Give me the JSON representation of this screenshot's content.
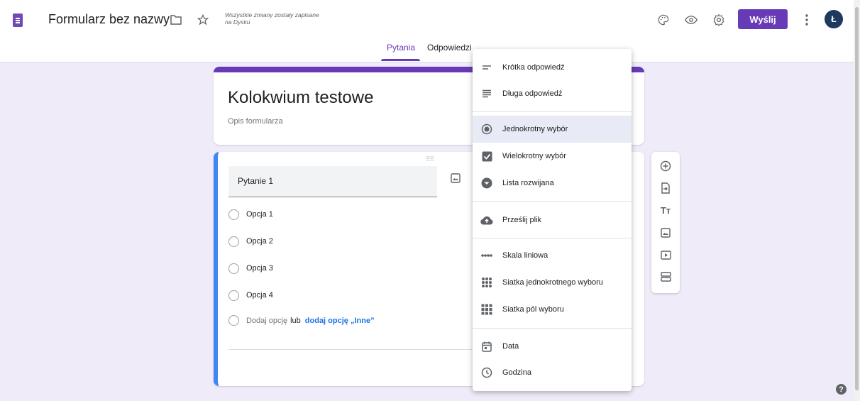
{
  "header": {
    "title": "Formularz bez nazwy",
    "save_status": "Wszystkie zmiany zostały zapisane na Dysku",
    "send_label": "Wyślij",
    "avatar_letter": "Ł",
    "icons": [
      "folder-icon",
      "star-icon",
      "palette-icon",
      "preview-icon",
      "settings-icon",
      "more-vert-icon"
    ],
    "brand_color": "#673ab7"
  },
  "tabs": [
    {
      "label": "Pytania",
      "active": true
    },
    {
      "label": "Odpowiedzi",
      "active": false
    }
  ],
  "form": {
    "title": "Kolokwium testowe",
    "description_placeholder": "Opis formularza"
  },
  "question": {
    "title": "Pytanie 1",
    "options": [
      "Opcja 1",
      "Opcja 2",
      "Opcja 3",
      "Opcja 4"
    ],
    "add_option": "Dodaj opcję",
    "or": "lub",
    "add_other": "dodaj opcję „Inne”"
  },
  "menu": {
    "items": [
      {
        "label": "Krótka odpowiedź",
        "icon": "short-text-icon"
      },
      {
        "label": "Długa odpowiedź",
        "icon": "paragraph-icon"
      },
      {
        "label": "Jednokrotny wybór",
        "icon": "radio-icon",
        "selected": true
      },
      {
        "label": "Wielokrotny wybór",
        "icon": "checkbox-icon"
      },
      {
        "label": "Lista rozwijana",
        "icon": "dropdown-icon"
      },
      {
        "label": "Prześlij plik",
        "icon": "cloud-upload-icon"
      },
      {
        "label": "Skala liniowa",
        "icon": "linear-scale-icon"
      },
      {
        "label": "Siatka jednokrotnego wyboru",
        "icon": "grid-icon"
      },
      {
        "label": "Siatka pól wyboru",
        "icon": "checkbox-grid-icon"
      },
      {
        "label": "Data",
        "icon": "calendar-icon"
      },
      {
        "label": "Godzina",
        "icon": "clock-icon"
      }
    ]
  },
  "help_label": "?"
}
